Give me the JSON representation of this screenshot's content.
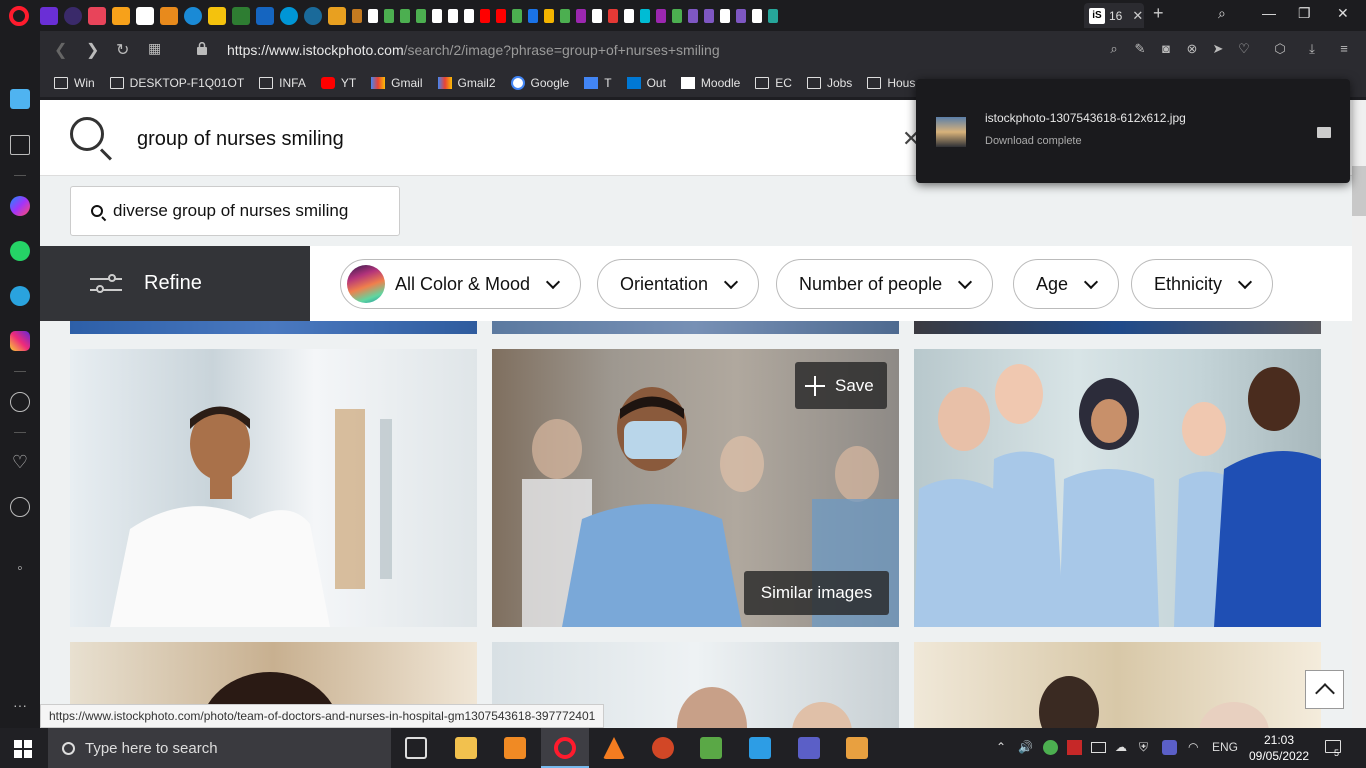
{
  "browser": {
    "active_tab_title": "16",
    "url_host": "https://www.istockphoto.com",
    "url_path": "/search/2/image?phrase=group+of+nurses+smiling",
    "hover_link": "https://www.istockphoto.com/photo/team-of-doctors-and-nurses-in-hospital-gm1307543618-397772401"
  },
  "bookmarks": [
    {
      "label": "Win",
      "icon": "folder-icon"
    },
    {
      "label": "DESKTOP-F1Q01OT",
      "icon": "folder-icon"
    },
    {
      "label": "INFA",
      "icon": "folder-icon"
    },
    {
      "label": "YT",
      "icon": "youtube-icon"
    },
    {
      "label": "Gmail",
      "icon": "gmail-icon"
    },
    {
      "label": "Gmail2",
      "icon": "gmail-icon"
    },
    {
      "label": "Google",
      "icon": "google-icon"
    },
    {
      "label": "T",
      "icon": "translate-icon"
    },
    {
      "label": "Out",
      "icon": "outlook-icon"
    },
    {
      "label": "Moodle",
      "icon": "moodle-icon"
    },
    {
      "label": "EC",
      "icon": "folder-icon"
    },
    {
      "label": "Jobs",
      "icon": "folder-icon"
    },
    {
      "label": "Hous",
      "icon": "folder-icon"
    }
  ],
  "search": {
    "query": "group of nurses smiling",
    "suggestion": "diverse group of nurses smiling"
  },
  "filters": {
    "refine_label": "Refine",
    "chips": [
      "All Color & Mood",
      "Orientation",
      "Number of people",
      "Age",
      "Ethnicity"
    ]
  },
  "results": {
    "save_label": "Save",
    "similar_label": "Similar images"
  },
  "download": {
    "filename": "istockphoto-1307543618-612x612.jpg",
    "status": "Download complete"
  },
  "taskbar": {
    "search_placeholder": "Type here to search",
    "lang": "ENG",
    "time": "21:03",
    "date": "09/05/2022",
    "notif_count": "5"
  },
  "colors": {
    "opera_red": "#ff1b2d",
    "refine_bg": "#333438",
    "page_bg": "#eef1f2"
  }
}
